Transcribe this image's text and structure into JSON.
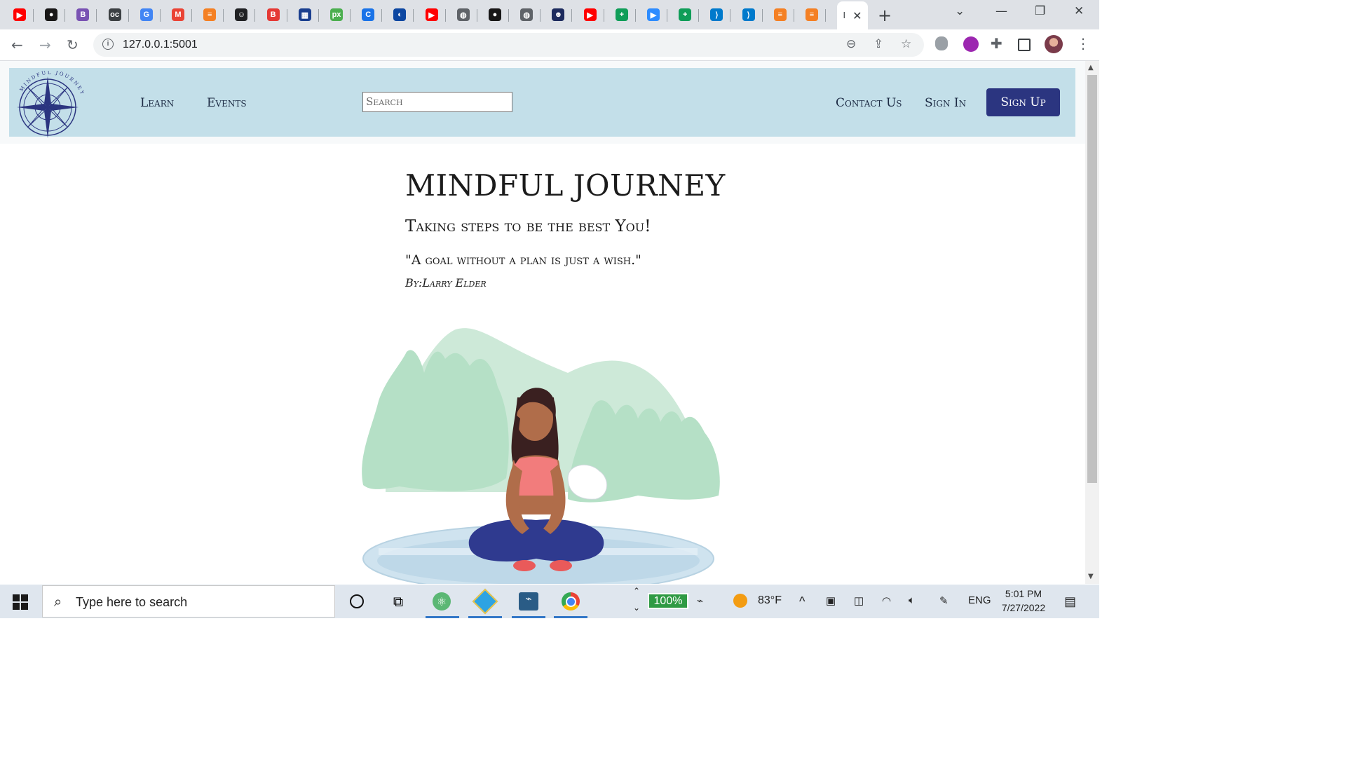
{
  "browser": {
    "tabs": [
      {
        "icon": "youtube-icon",
        "color": "#ff0000"
      },
      {
        "icon": "github-icon",
        "color": "#181717"
      },
      {
        "icon": "bootstrap-icon",
        "color": "#7952b3"
      },
      {
        "icon": "oc-icon",
        "color": "#3c4043"
      },
      {
        "icon": "google-translate-icon",
        "color": "#4285f4"
      },
      {
        "icon": "gmail-icon",
        "color": "#ea4335"
      },
      {
        "icon": "stackoverflow-icon",
        "color": "#f48024"
      },
      {
        "icon": "smiley-icon",
        "color": "#202124"
      },
      {
        "icon": "brand-b-icon",
        "color": "#e53935"
      },
      {
        "icon": "grid-icon",
        "color": "#1a3f8f"
      },
      {
        "icon": "px-icon",
        "color": "#4caf50"
      },
      {
        "icon": "c-icon",
        "color": "#1a73e8"
      },
      {
        "icon": "globe-blue-icon",
        "color": "#0d47a1"
      },
      {
        "icon": "youtube-icon",
        "color": "#ff0000"
      },
      {
        "icon": "globe-icon",
        "color": "#5f6368"
      },
      {
        "icon": "github-icon",
        "color": "#181717"
      },
      {
        "icon": "globe-icon",
        "color": "#5f6368"
      },
      {
        "icon": "avatar-icon",
        "color": "#1d2b5e"
      },
      {
        "icon": "youtube-icon",
        "color": "#ff0000"
      },
      {
        "icon": "sheets-icon",
        "color": "#0f9d58"
      },
      {
        "icon": "zoom-icon",
        "color": "#2d8cff"
      },
      {
        "icon": "sheets-icon",
        "color": "#0f9d58"
      },
      {
        "icon": "vscode-icon",
        "color": "#007acc"
      },
      {
        "icon": "vscode-icon",
        "color": "#007acc"
      },
      {
        "icon": "stackoverflow-icon",
        "color": "#f48024"
      },
      {
        "icon": "stackoverflow-icon",
        "color": "#f48024"
      }
    ],
    "active_tab_title": "I",
    "new_tab": "+",
    "url": "127.0.0.1:5001"
  },
  "site": {
    "logo_text": "MINDFUL JOURNEY",
    "nav": {
      "learn": "Learn",
      "events": "Events",
      "search_placeholder": "Search",
      "contact": "Contact Us",
      "signin": "Sign In",
      "signup": "Sign Up"
    },
    "hero": {
      "title": "MINDFUL JOURNEY",
      "subtitle": "Taking steps to be the best You!",
      "quote": "\"A goal without a plan is just a wish.\"",
      "author": "By:Larry Elder"
    },
    "colors": {
      "header_bg": "#c3dfe9",
      "accent": "#2b3580",
      "hill": "#cde9d8",
      "trees": "#b5e0c6",
      "pond": "#cfe3ef"
    }
  },
  "taskbar": {
    "search_placeholder": "Type here to search",
    "battery": "100%",
    "temperature": "83°F",
    "language": "ENG",
    "time": "5:01 PM",
    "date": "7/27/2022"
  }
}
